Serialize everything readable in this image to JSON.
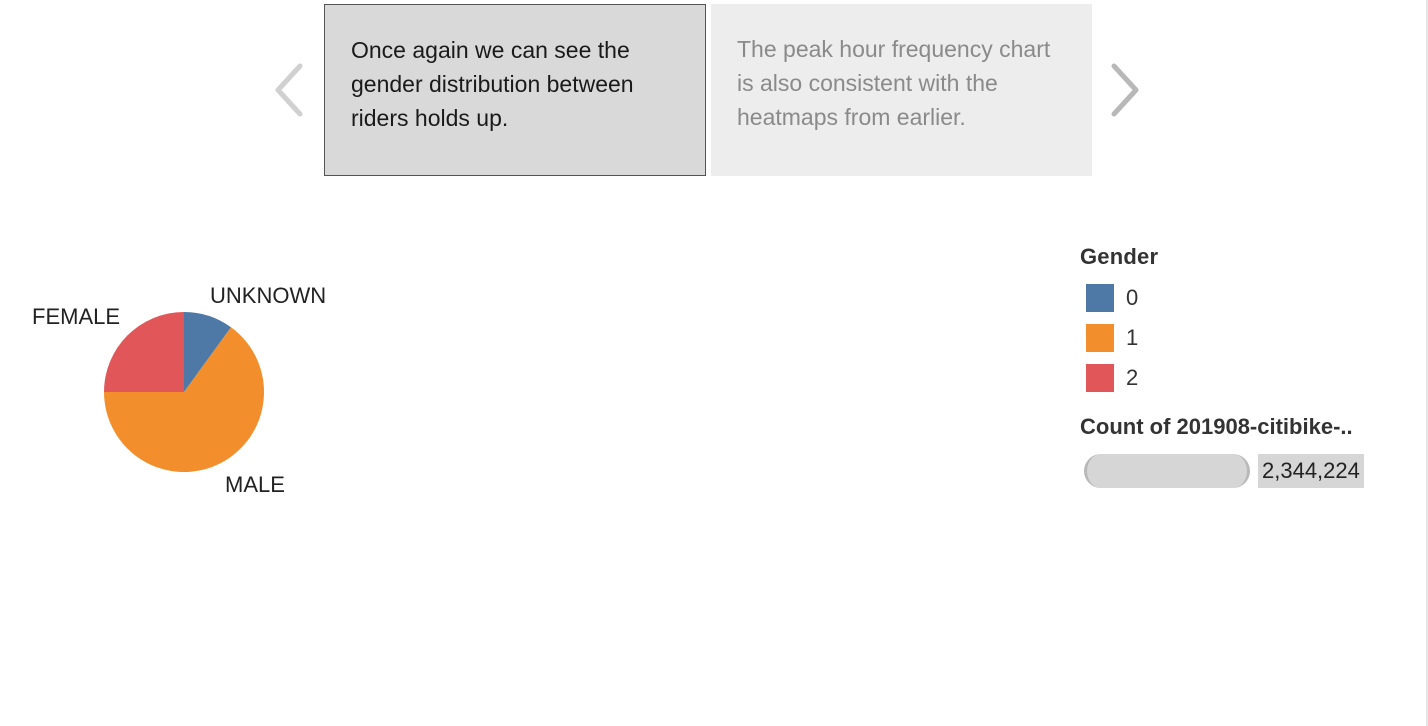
{
  "story": {
    "prev_arrow": "chevron-left-icon",
    "next_arrow": "chevron-right-icon",
    "points": [
      {
        "text": "Once again we can see the gender distribution between riders holds up.",
        "active": true
      },
      {
        "text": "The peak hour frequency chart is also consistent with the heatmaps from earlier.",
        "active": false
      }
    ]
  },
  "chart_data": {
    "type": "pie",
    "slices": [
      {
        "label": "UNKNOWN",
        "value": 0.1,
        "color": "#4e79a7"
      },
      {
        "label": "MALE",
        "value": 0.65,
        "color": "#f28e2b"
      },
      {
        "label": "FEMALE",
        "value": 0.25,
        "color": "#e15759"
      }
    ]
  },
  "legend": {
    "title": "Gender",
    "items": [
      {
        "label": "0",
        "color": "#4e79a7"
      },
      {
        "label": "1",
        "color": "#f28e2b"
      },
      {
        "label": "2",
        "color": "#e15759"
      }
    ]
  },
  "count_filter": {
    "title": "Count of 201908-citibike-..",
    "value": "2,344,224"
  }
}
